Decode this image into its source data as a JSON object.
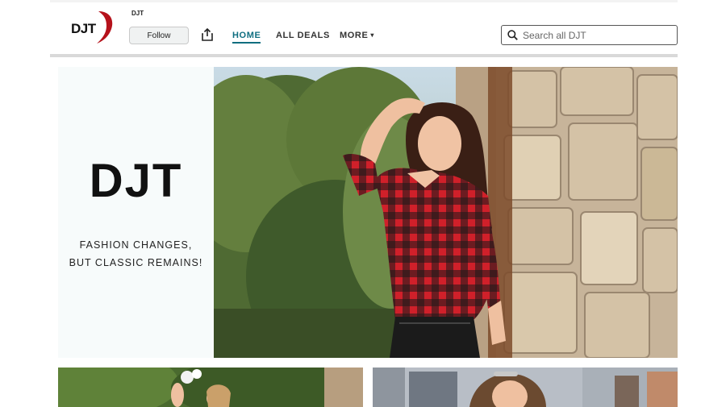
{
  "header": {
    "logo_text": "DJT",
    "brand_name": "DJT",
    "follow_label": "Follow",
    "nav": {
      "home": "HOME",
      "all_deals": "ALL DEALS",
      "more": "MORE"
    },
    "search": {
      "placeholder": "Search all DJT"
    }
  },
  "hero": {
    "title": "DJT",
    "tagline_line1": "FASHION CHANGES,",
    "tagline_line2": "BUT CLASSIC REMAINS!"
  },
  "colors": {
    "accent": "#0f6e80",
    "logo_red": "#b5121b",
    "shirt_red": "#d0202a"
  },
  "icons": [
    "share-icon",
    "search-icon",
    "caret-down-icon"
  ]
}
